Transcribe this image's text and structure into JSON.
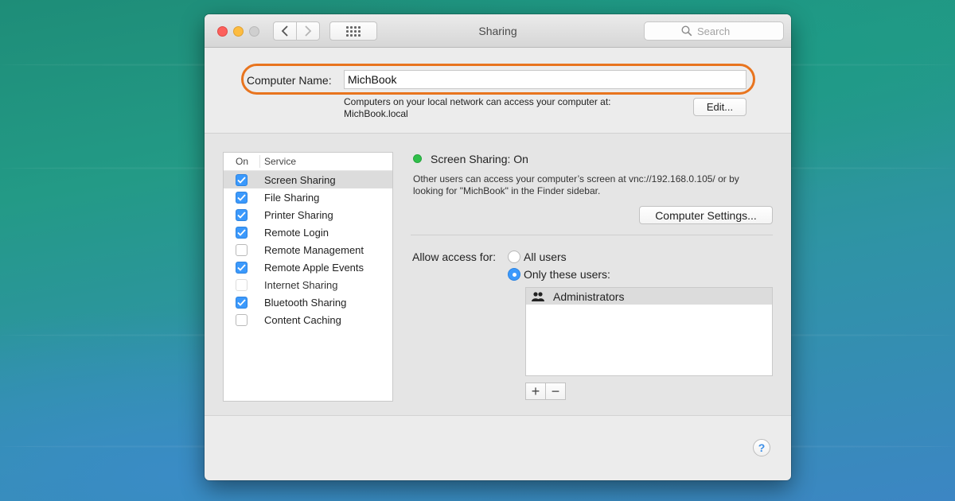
{
  "window": {
    "title": "Sharing",
    "search_placeholder": "Search"
  },
  "computer_name": {
    "label": "Computer Name:",
    "value": "MichBook",
    "help_line1": "Computers on your local network can access your computer at:",
    "help_line2": "MichBook.local",
    "edit_label": "Edit..."
  },
  "services": {
    "header_on": "On",
    "header_service": "Service",
    "items": [
      {
        "label": "Screen Sharing",
        "checked": true,
        "selected": true
      },
      {
        "label": "File Sharing",
        "checked": true,
        "selected": false
      },
      {
        "label": "Printer Sharing",
        "checked": true,
        "selected": false
      },
      {
        "label": "Remote Login",
        "checked": true,
        "selected": false
      },
      {
        "label": "Remote Management",
        "checked": false,
        "selected": false
      },
      {
        "label": "Remote Apple Events",
        "checked": true,
        "selected": false
      },
      {
        "label": "Internet Sharing",
        "checked": false,
        "selected": false,
        "disabled": true
      },
      {
        "label": "Bluetooth Sharing",
        "checked": true,
        "selected": false
      },
      {
        "label": "Content Caching",
        "checked": false,
        "selected": false
      }
    ]
  },
  "detail": {
    "status": "Screen Sharing: On",
    "status_color": "#2fbf4a",
    "desc_line1": "Other users can access your computer’s screen at vnc://192.168.0.105/ or by",
    "desc_line2": "looking for \"MichBook\" in the Finder sidebar.",
    "settings_label": "Computer Settings...",
    "access_label": "Allow access for:",
    "option_all": "All users",
    "option_only": "Only these users:",
    "selected_option": "only",
    "users": [
      "Administrators"
    ],
    "add_label": "+",
    "remove_label": "−"
  },
  "help_label": "?",
  "colors": {
    "accent": "#3b99fc",
    "highlight_ring": "#e8741e"
  }
}
